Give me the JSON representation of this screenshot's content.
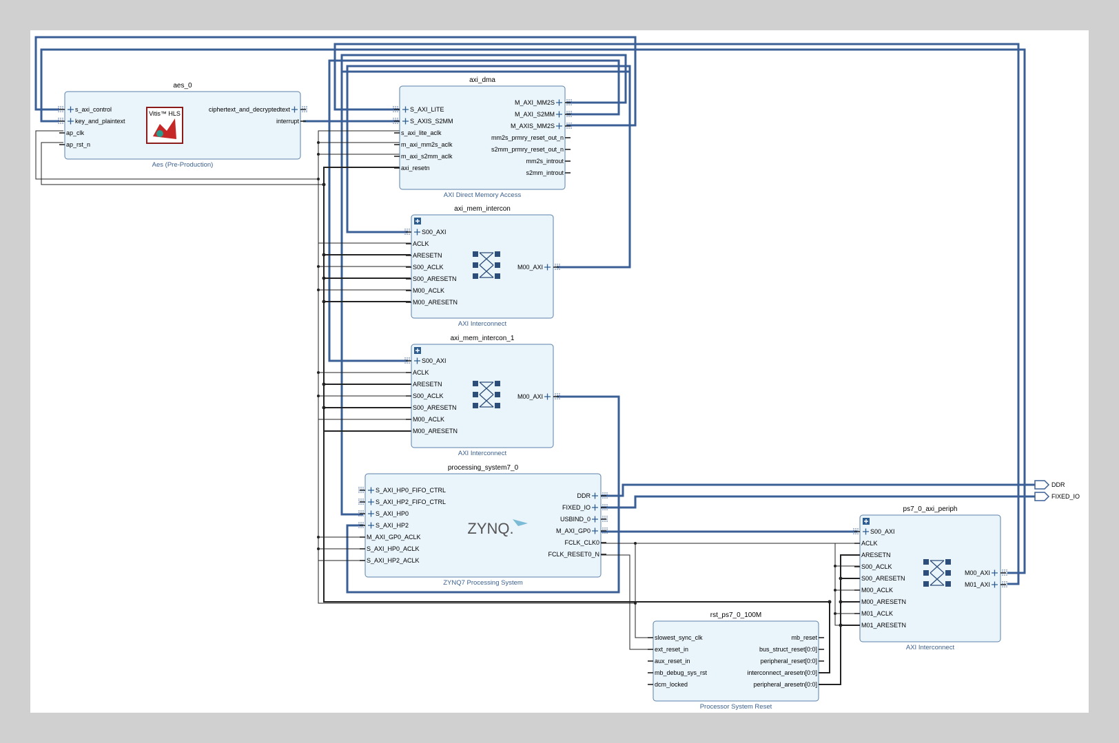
{
  "blocks": {
    "aes": {
      "name": "aes_0",
      "subtitle": "Aes (Pre-Production)",
      "logo": "Vitis™ HLS",
      "left": [
        "s_axi_control",
        "key_and_plaintext",
        "ap_clk",
        "ap_rst_n"
      ],
      "right": [
        "ciphertext_and_decryptedtext",
        "interrupt"
      ]
    },
    "dma": {
      "name": "axi_dma",
      "subtitle": "AXI Direct Memory Access",
      "left": [
        "S_AXI_LITE",
        "S_AXIS_S2MM",
        "s_axi_lite_aclk",
        "m_axi_mm2s_aclk",
        "m_axi_s2mm_aclk",
        "axi_resetn"
      ],
      "right": [
        "M_AXI_MM2S",
        "M_AXI_S2MM",
        "M_AXIS_MM2S",
        "mm2s_prmry_reset_out_n",
        "s2mm_prmry_reset_out_n",
        "mm2s_introut",
        "s2mm_introut"
      ]
    },
    "ic0": {
      "name": "axi_mem_intercon",
      "subtitle": "AXI Interconnect",
      "left": [
        "S00_AXI",
        "ACLK",
        "ARESETN",
        "S00_ACLK",
        "S00_ARESETN",
        "M00_ACLK",
        "M00_ARESETN"
      ],
      "right": [
        "M00_AXI"
      ]
    },
    "ic1": {
      "name": "axi_mem_intercon_1",
      "subtitle": "AXI Interconnect",
      "left": [
        "S00_AXI",
        "ACLK",
        "ARESETN",
        "S00_ACLK",
        "S00_ARESETN",
        "M00_ACLK",
        "M00_ARESETN"
      ],
      "right": [
        "M00_AXI"
      ]
    },
    "ps7": {
      "name": "processing_system7_0",
      "subtitle": "ZYNQ7 Processing System",
      "logo": "ZYNQ.",
      "left": [
        "S_AXI_HP0_FIFO_CTRL",
        "S_AXI_HP2_FIFO_CTRL",
        "S_AXI_HP0",
        "S_AXI_HP2",
        "M_AXI_GP0_ACLK",
        "S_AXI_HP0_ACLK",
        "S_AXI_HP2_ACLK"
      ],
      "right": [
        "DDR",
        "FIXED_IO",
        "USBIND_0",
        "M_AXI_GP0",
        "FCLK_CLK0",
        "FCLK_RESET0_N"
      ]
    },
    "periph": {
      "name": "ps7_0_axi_periph",
      "subtitle": "AXI Interconnect",
      "left": [
        "S00_AXI",
        "ACLK",
        "ARESETN",
        "S00_ACLK",
        "S00_ARESETN",
        "M00_ACLK",
        "M00_ARESETN",
        "M01_ACLK",
        "M01_ARESETN"
      ],
      "right": [
        "M00_AXI",
        "M01_AXI"
      ]
    },
    "rst": {
      "name": "rst_ps7_0_100M",
      "subtitle": "Processor System Reset",
      "left": [
        "slowest_sync_clk",
        "ext_reset_in",
        "aux_reset_in",
        "mb_debug_sys_rst",
        "dcm_locked"
      ],
      "right": [
        "mb_reset",
        "bus_struct_reset[0:0]",
        "peripheral_reset[0:0]",
        "interconnect_aresetn[0:0]",
        "peripheral_aresetn[0:0]"
      ]
    }
  },
  "external_ports": [
    "DDR",
    "FIXED_IO"
  ]
}
